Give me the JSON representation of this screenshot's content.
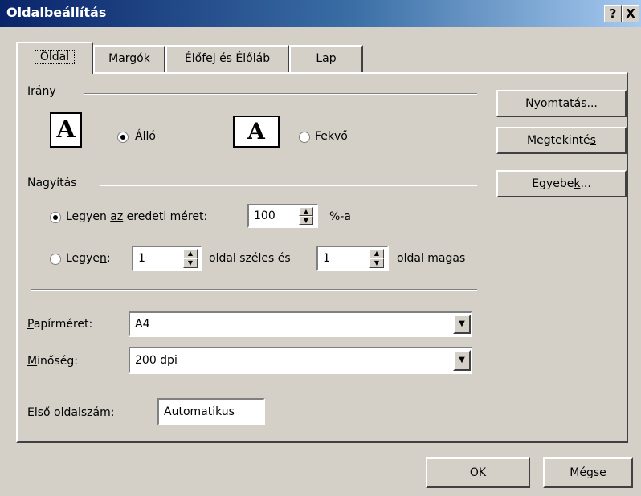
{
  "window": {
    "title": "Oldalbeállítás",
    "help_button": "?",
    "close_button": "X"
  },
  "tabs": [
    {
      "label": "Oldal",
      "active": true
    },
    {
      "label": "Margók",
      "active": false
    },
    {
      "label": "Élőfej és Élőláb",
      "active": false
    },
    {
      "label": "Lap",
      "active": false
    }
  ],
  "orientation": {
    "group_label": "Irány",
    "portrait": {
      "label": "Álló",
      "selected": true
    },
    "landscape": {
      "label": "Fekvő",
      "selected": false
    },
    "icon_glyph": "A"
  },
  "scaling": {
    "group_label": "Nagyítás",
    "adjust": {
      "label_pre": "Legyen ",
      "label_ul": "az",
      "label_post": " eredeti méret:",
      "value": "100",
      "suffix": "%-a",
      "selected": true
    },
    "fit": {
      "label_pre": "Legye",
      "label_ul": "n",
      "label_post": ":",
      "wide_value": "1",
      "wide_label": "oldal széles és",
      "tall_value": "1",
      "tall_label": "oldal magas",
      "selected": false
    }
  },
  "paper_size": {
    "label_ul": "P",
    "label_rest": "apírméret:",
    "value": "A4"
  },
  "print_quality": {
    "label_ul": "M",
    "label_rest": "inőség:",
    "value": "200 dpi"
  },
  "first_page": {
    "label_ul": "E",
    "label_rest": "lső oldalszám:",
    "value": "Automatikus"
  },
  "side_buttons": {
    "print": {
      "pre": "Ny",
      "ul": "o",
      "post": "mtatás..."
    },
    "preview": {
      "pre": "Megtekinté",
      "ul": "s",
      "post": ""
    },
    "options": {
      "pre": "Egyebe",
      "ul": "k",
      "post": "..."
    }
  },
  "footer": {
    "ok_label": "OK",
    "cancel_label": "Mégse"
  }
}
